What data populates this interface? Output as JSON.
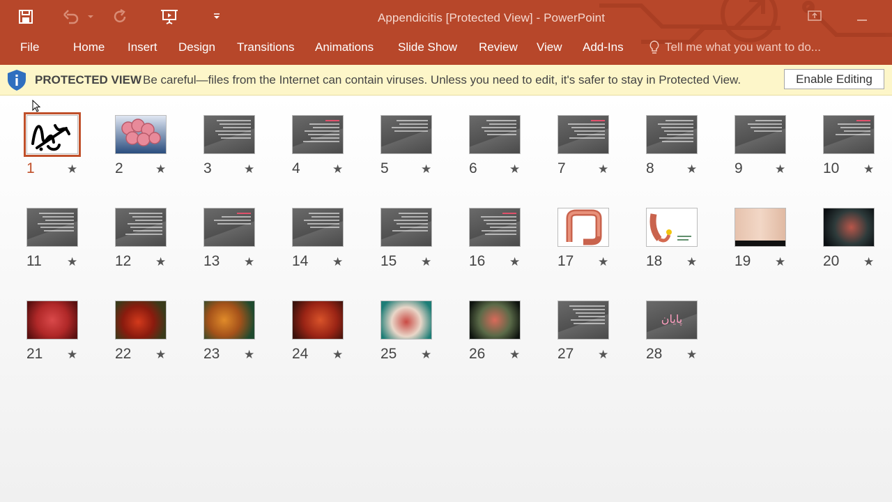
{
  "window": {
    "title": "Appendicitis [Protected View] - PowerPoint"
  },
  "quick_access": {
    "icons": [
      "save-icon",
      "undo-icon",
      "undo-dropdown-icon",
      "redo-icon",
      "slideshow-from-beginning-icon",
      "customize-qat-icon"
    ]
  },
  "ribbon": {
    "tabs": [
      "File",
      "Home",
      "Insert",
      "Design",
      "Transitions",
      "Animations",
      "Slide Show",
      "Review",
      "View",
      "Add-Ins"
    ],
    "tell_me_placeholder": "Tell me what you want to do..."
  },
  "protected_view": {
    "label": "PROTECTED VIEW",
    "message": "Be careful—files from the Internet can contain viruses. Unless you need to edit, it's safer to stay in Protected View.",
    "enable_button": "Enable Editing"
  },
  "slides": [
    {
      "number": "1",
      "kind": "calligraphy",
      "selected": true
    },
    {
      "number": "2",
      "kind": "intestine"
    },
    {
      "number": "3",
      "kind": "text"
    },
    {
      "number": "4",
      "kind": "text"
    },
    {
      "number": "5",
      "kind": "text"
    },
    {
      "number": "6",
      "kind": "text"
    },
    {
      "number": "7",
      "kind": "text"
    },
    {
      "number": "8",
      "kind": "text"
    },
    {
      "number": "9",
      "kind": "text"
    },
    {
      "number": "10",
      "kind": "text"
    },
    {
      "number": "11",
      "kind": "text"
    },
    {
      "number": "12",
      "kind": "text"
    },
    {
      "number": "13",
      "kind": "text"
    },
    {
      "number": "14",
      "kind": "text"
    },
    {
      "number": "15",
      "kind": "text"
    },
    {
      "number": "16",
      "kind": "text"
    },
    {
      "number": "17",
      "kind": "colon-diagram"
    },
    {
      "number": "18",
      "kind": "appendix-diagram"
    },
    {
      "number": "19",
      "kind": "abdomen-photo"
    },
    {
      "number": "20",
      "kind": "surgery-photo"
    },
    {
      "number": "21",
      "kind": "surgery-photo"
    },
    {
      "number": "22",
      "kind": "surgery-photo"
    },
    {
      "number": "23",
      "kind": "surgery-photo"
    },
    {
      "number": "24",
      "kind": "surgery-photo"
    },
    {
      "number": "25",
      "kind": "surgery-photo"
    },
    {
      "number": "26",
      "kind": "surgery-photo"
    },
    {
      "number": "27",
      "kind": "text"
    },
    {
      "number": "28",
      "kind": "title",
      "text": "پایان"
    }
  ],
  "colors": {
    "accent": "#b7472a",
    "selection": "#c0502a",
    "protected_bar": "#fdf6c9"
  }
}
